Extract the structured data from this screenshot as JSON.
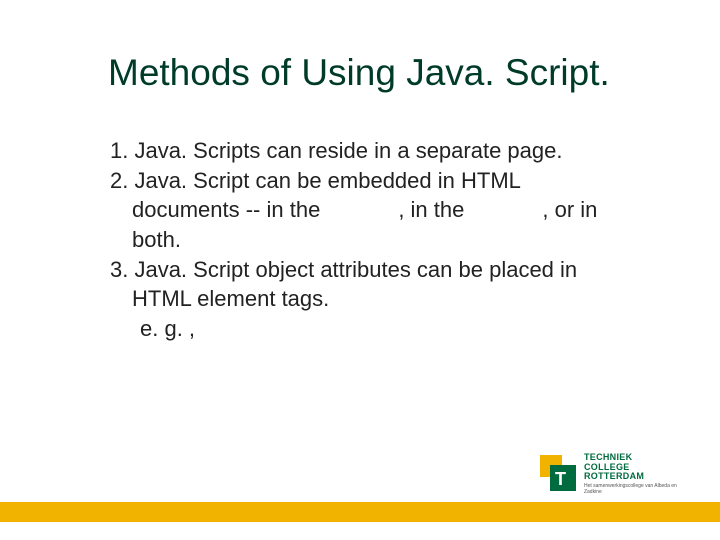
{
  "title": "Methods of Using Java. Script.",
  "body": {
    "item1": "1. Java. Scripts can reside in a separate page.",
    "item2": "2. Java. Script can be embedded in HTML",
    "item2b_a": "documents -- in the",
    "item2b_b": ", in the",
    "item2b_c": ", or in",
    "item2c": "both.",
    "item3": "3. Java. Script object attributes can be placed in",
    "item3b": "HTML element tags.",
    "item3c": "e. g. ,"
  },
  "logo": {
    "line1": "TECHNIEK",
    "line2": "COLLEGE",
    "line3": "ROTTERDAM",
    "sub": "Het samenwerkingscollege van Albeda en Zadkine"
  }
}
